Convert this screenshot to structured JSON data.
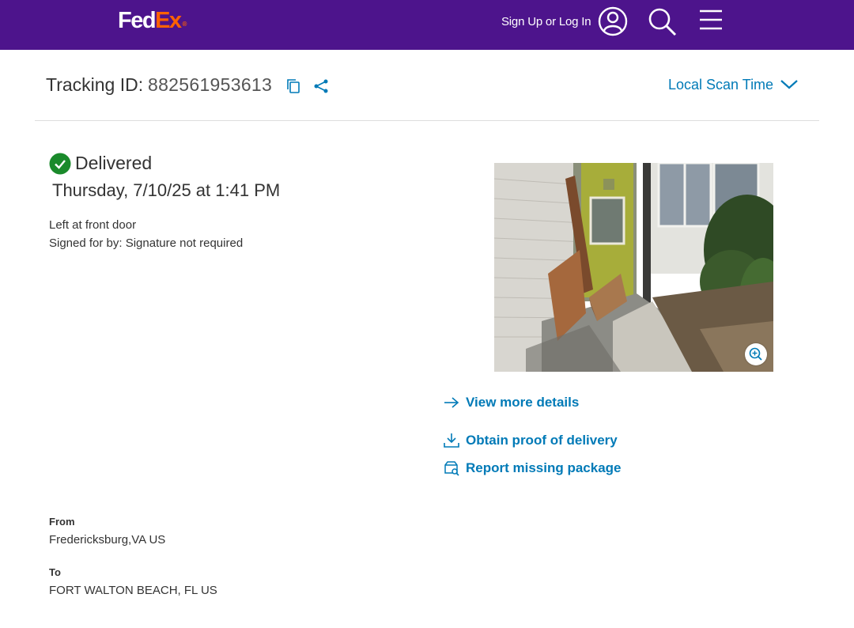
{
  "header": {
    "logo_main": "Fed",
    "logo_accent": "Ex",
    "logo_mark": "®",
    "signin_label": "Sign Up or Log In",
    "icons": [
      "user-circle-icon",
      "search-icon",
      "hamburger-menu-icon"
    ],
    "bg_color": "#4d148c",
    "accent_color": "#ff6200"
  },
  "tracking": {
    "label": "Tracking ID:",
    "number": "882561953613",
    "icons": [
      "copy-icon",
      "share-icon"
    ],
    "scan_time_label": "Local Scan Time",
    "link_color": "#007ab7"
  },
  "status": {
    "label": "Delivered",
    "datetime": "Thursday, 7/10/25 at 1:41 PM",
    "location": "Left at front door",
    "signed_for": "Signed for by: Signature not required",
    "status_color": "#1a8a2b"
  },
  "photo": {
    "icon": "zoom-in-icon"
  },
  "links": {
    "more_details": "View more details",
    "proof": "Obtain proof of delivery",
    "missing": "Report missing package"
  },
  "shipment": {
    "from_label": "From",
    "from_value": "Fredericksburg,VA US",
    "to_label": "To",
    "to_value": "FORT WALTON BEACH, FL US"
  }
}
